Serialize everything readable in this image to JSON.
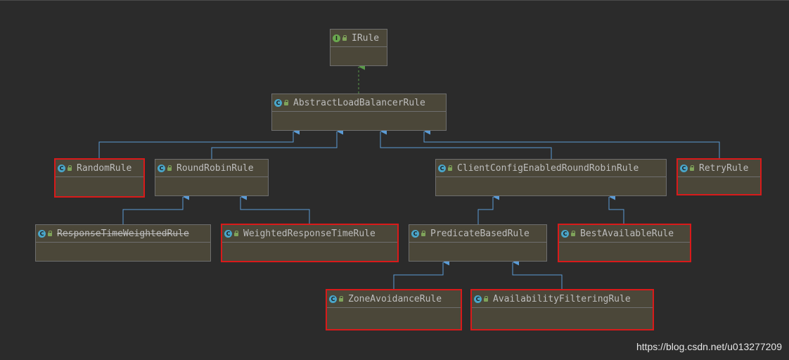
{
  "nodes": {
    "irule": {
      "label": "IRule",
      "kind": "interface"
    },
    "abstract": {
      "label": "AbstractLoadBalancerRule",
      "kind": "class"
    },
    "random": {
      "label": "RandomRule",
      "kind": "class"
    },
    "roundrobin": {
      "label": "RoundRobinRule",
      "kind": "class"
    },
    "clientconfig": {
      "label": "ClientConfigEnabledRoundRobinRule",
      "kind": "class"
    },
    "retry": {
      "label": "RetryRule",
      "kind": "class"
    },
    "responsetime": {
      "label": "ResponseTimeWeightedRule",
      "kind": "class",
      "deprecated": true
    },
    "weighted": {
      "label": "WeightedResponseTimeRule",
      "kind": "class"
    },
    "predicate": {
      "label": "PredicateBasedRule",
      "kind": "class"
    },
    "bestavailable": {
      "label": "BestAvailableRule",
      "kind": "class"
    },
    "zone": {
      "label": "ZoneAvoidanceRule",
      "kind": "class"
    },
    "availability": {
      "label": "AvailabilityFilteringRule",
      "kind": "class"
    }
  },
  "icons": {
    "class": "C",
    "interface": "I"
  },
  "colors": {
    "highlight": "#d91a1a",
    "inherit_line": "#5b9bd5",
    "implement_line": "#5a9a4a"
  },
  "watermark": "https://blog.csdn.net/u013277209"
}
